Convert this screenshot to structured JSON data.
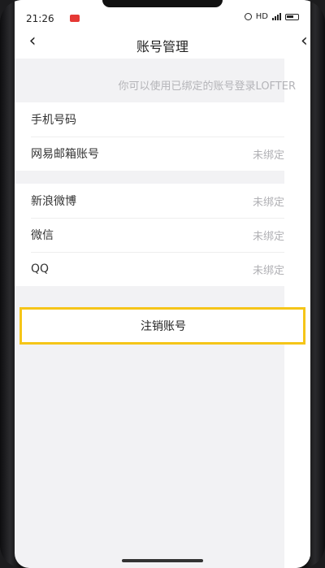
{
  "status": {
    "time": "21:26",
    "network": "HD"
  },
  "nav": {
    "title": "账号管理"
  },
  "hint": "你可以使用已绑定的账号登录LOFTER",
  "group1": [
    {
      "label": "手机号码",
      "value": ""
    },
    {
      "label": "网易邮箱账号",
      "value": "未绑定"
    }
  ],
  "group2": [
    {
      "label": "新浪微博",
      "value": "未绑定"
    },
    {
      "label": "微信",
      "value": "未绑定"
    },
    {
      "label": "QQ",
      "value": "未绑定"
    }
  ],
  "logout_label": "注销账号",
  "icons": [
    "chevron-left-icon",
    "alarm-icon",
    "signal-icon",
    "battery-icon",
    "record-icon"
  ]
}
